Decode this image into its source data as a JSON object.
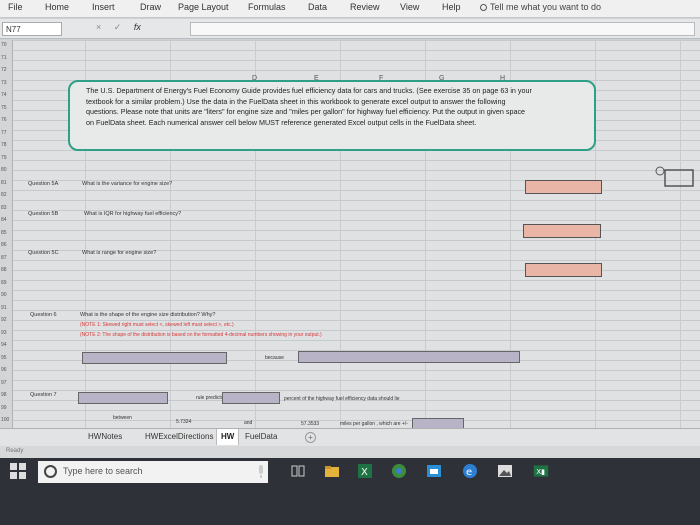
{
  "ribbon": {
    "tabs": [
      "File",
      "Home",
      "Insert",
      "Draw",
      "Page Layout",
      "Formulas",
      "Data",
      "Review",
      "View",
      "Help"
    ],
    "tell_me": "Tell me what you want to do"
  },
  "formula_bar": {
    "name_box": "N77",
    "cancel": "×",
    "enter": "✓",
    "fx": "fx"
  },
  "grid": {
    "col_letters": [
      "D",
      "E",
      "F",
      "G",
      "H"
    ],
    "row_numbers": [
      "70",
      "71",
      "72",
      "73",
      "74",
      "75",
      "76",
      "77",
      "78",
      "79",
      "80",
      "81",
      "82",
      "83",
      "84",
      "85",
      "86",
      "87",
      "88",
      "89",
      "90",
      "91",
      "92",
      "93",
      "94",
      "95",
      "96",
      "97",
      "98",
      "99",
      "100"
    ]
  },
  "textbox": {
    "line1": "The U.S. Department of Energy's Fuel Economy Guide provides fuel efficiency data for cars and trucks. (See exercise 35 on page 63 in your",
    "line2": "textbook for a similar problem.) Use the data in the FuelData sheet in this workbook to generate excel output to answer the following",
    "line3": "questions. Please note that units are \"liters\" for engine size and \"miles per gallon\" for highway fuel efficiency. Put the output in given space",
    "line4": "on FuelData sheet. Each numerical answer cell below MUST reference generated Excel output cells in the FuelData sheet."
  },
  "questions": {
    "q5a_label": "Question 5A",
    "q5a_text": "What is the variance for engine size?",
    "q5b_label": "Question 5B",
    "q5b_text": "What is IQR for highway fuel efficiency?",
    "q5c_label": "Question 5C",
    "q5c_text": "What is range for engine size?",
    "q6_label": "Question 6",
    "q6_text": "What is the shape of the engine size distribution? Why?",
    "q6_note1": "(NOTE 1: Skewed right must select <, skewed left must select >, etc.)",
    "q6_note2": "(NOTE 2: The shape of the distribution is based on the formatted 4-decimal numbers showing in your output.)",
    "because": "because",
    "q7_label": "Question 7",
    "rule_predicts": "rule predicts that",
    "percent_text": "percent of the highway fuel efficiency data should lie",
    "between": "between",
    "value1": "5.7324",
    "and": "and",
    "value2": "57.3533",
    "mpg_text": "miles per gallon , which are +/-"
  },
  "sheets": {
    "tabs": [
      "HWNotes",
      "HWExcelDirections",
      "HW",
      "FuelData"
    ],
    "active": "HW"
  },
  "status": {
    "text": "Ready"
  },
  "taskbar": {
    "search_placeholder": "Type here to search"
  }
}
